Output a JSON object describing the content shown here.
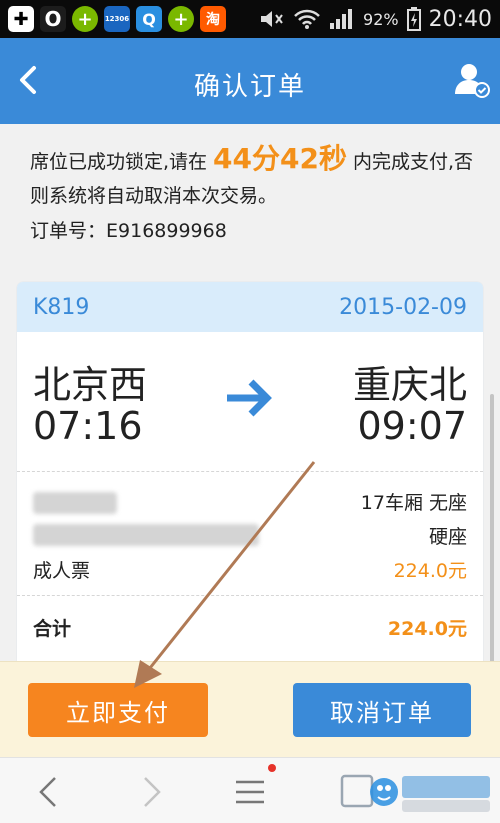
{
  "status_bar": {
    "app_icons": [
      {
        "name": "o-app-icon",
        "glyph": "O",
        "color": "#1c1c1c"
      },
      {
        "name": "plus-green-icon",
        "glyph": "+",
        "color": "#7ab800"
      },
      {
        "name": "train-12306-icon",
        "glyph": "12306",
        "color": "#1a66c0"
      },
      {
        "name": "browser-blue-icon",
        "glyph": "Q",
        "color": "#2a8fe0"
      },
      {
        "name": "plus-green-icon-2",
        "glyph": "+",
        "color": "#7ab800"
      },
      {
        "name": "taobao-icon",
        "glyph": "淘",
        "color": "#ff5a00"
      }
    ],
    "battery": "92%",
    "time": "20:40"
  },
  "header": {
    "title": "确认订单"
  },
  "notice": {
    "text_before": "席位已成功锁定,请在",
    "countdown": "44分42秒",
    "text_after": "内完成支付,否则系统将自动取消本次交易。",
    "order_label": "订单号：",
    "order_no": "E916899968"
  },
  "ticket": {
    "train_no": "K819",
    "date": "2015-02-09",
    "from_station": "北京西",
    "from_time": "07:16",
    "to_station": "重庆北",
    "to_time": "09:07",
    "carriage": "17车厢 无座",
    "seat_type": "硬座",
    "passenger_type": "成人票",
    "price": "224.0元"
  },
  "summary": {
    "total_label": "合计",
    "total_value": "224.0元"
  },
  "actions": {
    "pay_label": "立即支付",
    "cancel_label": "取消订单"
  },
  "colors": {
    "primary": "#3a8ad8",
    "accent": "#f6851f",
    "footer_bg": "#fbf3da"
  }
}
